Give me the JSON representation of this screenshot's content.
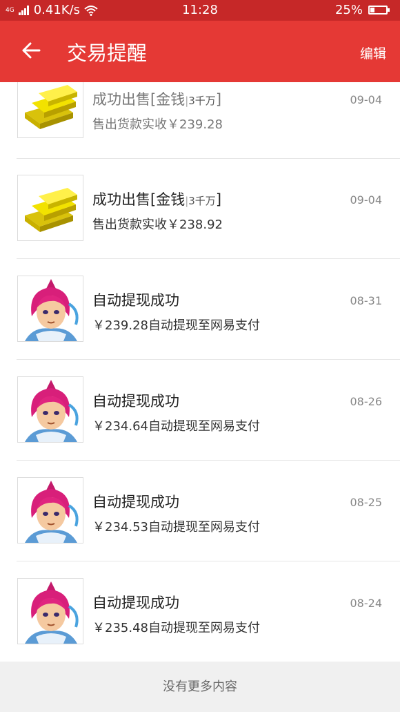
{
  "status_bar": {
    "network": "4G",
    "speed": "0.41K/s",
    "time": "11:28",
    "battery": "25%",
    "battery_level": 0.25
  },
  "app_bar": {
    "title": "交易提醒",
    "edit_label": "编辑"
  },
  "items": [
    {
      "title_main": "成功出售[金钱",
      "title_sub": "3千万",
      "title_end": "]",
      "desc": "售出货款实收￥239.28",
      "date": "09-04",
      "icon": "gold-bars-icon"
    },
    {
      "title_main": "成功出售[金钱",
      "title_sub": "3千万",
      "title_end": "]",
      "desc": "售出货款实收￥238.92",
      "date": "09-04",
      "icon": "gold-bars-icon"
    },
    {
      "title": "自动提现成功",
      "desc": "￥239.28自动提现至网易支付",
      "date": "08-31",
      "icon": "character-avatar-icon"
    },
    {
      "title": "自动提现成功",
      "desc": "￥234.64自动提现至网易支付",
      "date": "08-26",
      "icon": "character-avatar-icon"
    },
    {
      "title": "自动提现成功",
      "desc": "￥234.53自动提现至网易支付",
      "date": "08-25",
      "icon": "character-avatar-icon"
    },
    {
      "title": "自动提现成功",
      "desc": "￥235.48自动提现至网易支付",
      "date": "08-24",
      "icon": "character-avatar-icon"
    }
  ],
  "footer": {
    "text": "没有更多内容"
  },
  "colors": {
    "status_bar": "#c62828",
    "app_bar": "#e53935",
    "background": "#f2f2f2"
  }
}
